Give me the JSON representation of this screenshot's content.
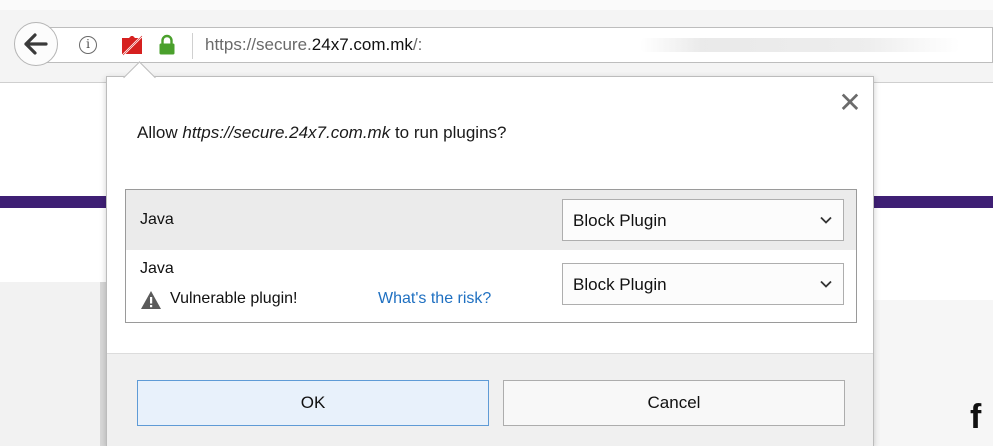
{
  "browser": {
    "url_prefix": "https://secure.",
    "url_domain": "24x7.com.mk",
    "url_suffix": "/:"
  },
  "icons": {
    "back": "back-arrow-icon",
    "info": "info-icon",
    "info_glyph": "i",
    "plugin": "plugin-blocked-icon",
    "lock": "lock-icon",
    "close": "close-icon",
    "close_glyph": "✕",
    "chevron": "chevron-down-icon",
    "warning": "warning-icon"
  },
  "dialog": {
    "question_prefix": "Allow ",
    "question_site": "https://secure.24x7.com.mk",
    "question_suffix": " to run plugins?",
    "plugins": [
      {
        "name": "Java",
        "action": "Block Plugin"
      },
      {
        "name": "Java",
        "action": "Block Plugin",
        "warning": "Vulnerable plugin!",
        "risk_link": "What's the risk?"
      }
    ],
    "ok_label": "OK",
    "cancel_label": "Cancel"
  },
  "page": {
    "glyph": "f"
  },
  "colors": {
    "accent": "#3e1f74",
    "link": "#1f70c1",
    "ok_border": "#5f9bd6",
    "lock_green": "#4aa02c",
    "plugin_red": "#d6201f"
  }
}
